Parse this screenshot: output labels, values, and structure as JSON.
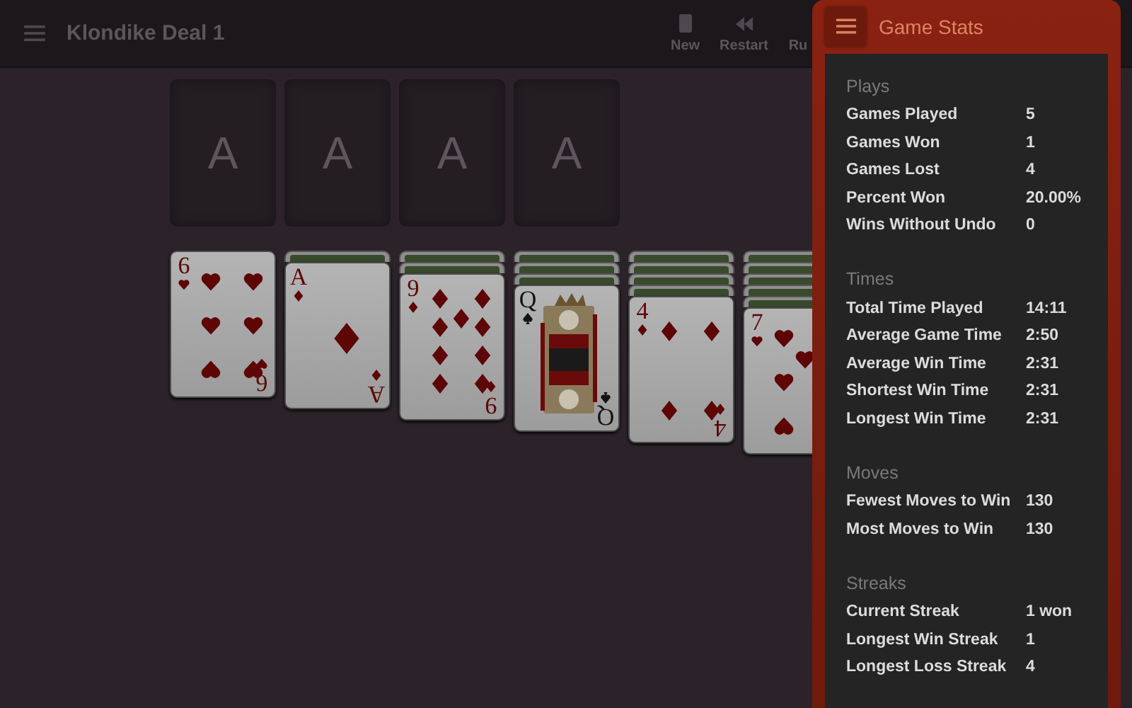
{
  "toolbar": {
    "title": "Klondike Deal 1",
    "buttons": [
      {
        "label": "New",
        "kind": "new"
      },
      {
        "label": "Restart",
        "kind": "restart"
      },
      {
        "label": "Ru",
        "kind": "other"
      }
    ]
  },
  "foundations": [
    {
      "label": "A"
    },
    {
      "label": "A"
    },
    {
      "label": "A"
    },
    {
      "label": "A"
    }
  ],
  "tableau": [
    {
      "cards": [
        {
          "face_up": true,
          "corners": [
            "6",
            "6"
          ],
          "kind": "hearts",
          "face_card": false
        }
      ]
    },
    {
      "cards": [
        {
          "face_up": false
        },
        {
          "face_up": true,
          "corners": [
            "A",
            "A"
          ],
          "kind": "diamonds",
          "face_card": false
        }
      ]
    },
    {
      "cards": [
        {
          "face_up": false
        },
        {
          "face_up": false
        },
        {
          "face_up": true,
          "corners": [
            "9",
            "9"
          ],
          "kind": "diamonds",
          "face_card": false
        }
      ]
    },
    {
      "cards": [
        {
          "face_up": false
        },
        {
          "face_up": false
        },
        {
          "face_up": false
        },
        {
          "face_up": true,
          "corners": [
            "Q",
            "Q"
          ],
          "kind": "spades",
          "face_card": true
        }
      ]
    },
    {
      "cards": [
        {
          "face_up": false
        },
        {
          "face_up": false
        },
        {
          "face_up": false
        },
        {
          "face_up": false
        },
        {
          "face_up": true,
          "corners": [
            "4",
            "4"
          ],
          "kind": "diamonds",
          "face_card": false
        }
      ]
    },
    {
      "cards": [
        {
          "face_up": false
        },
        {
          "face_up": false
        },
        {
          "face_up": false
        },
        {
          "face_up": false
        },
        {
          "face_up": false
        },
        {
          "face_up": true,
          "corners": [
            "7"
          ],
          "kind": "hearts",
          "face_card": false
        }
      ]
    }
  ],
  "stats_panel": {
    "title": "Game Stats",
    "sections": [
      {
        "title": "Plays",
        "rows": [
          {
            "label": "Games Played",
            "value": "5"
          },
          {
            "label": "Games Won",
            "value": "1"
          },
          {
            "label": "Games Lost",
            "value": "4"
          },
          {
            "label": "Percent Won",
            "value": "20.00%"
          },
          {
            "label": "Wins Without Undo",
            "value": "0"
          }
        ]
      },
      {
        "title": "Times",
        "rows": [
          {
            "label": "Total Time Played",
            "value": "14:11"
          },
          {
            "label": "Average Game Time",
            "value": "2:50"
          },
          {
            "label": "Average Win Time",
            "value": "2:31"
          },
          {
            "label": "Shortest Win Time",
            "value": "2:31"
          },
          {
            "label": "Longest Win Time",
            "value": "2:31"
          }
        ]
      },
      {
        "title": "Moves",
        "rows": [
          {
            "label": "Fewest Moves to Win",
            "value": "130"
          },
          {
            "label": "Most Moves to Win",
            "value": "130"
          }
        ]
      },
      {
        "title": "Streaks",
        "rows": [
          {
            "label": "Current Streak",
            "value": "1 won"
          },
          {
            "label": "Longest Win Streak",
            "value": "1"
          },
          {
            "label": "Longest Loss Streak",
            "value": "4"
          }
        ]
      }
    ]
  }
}
